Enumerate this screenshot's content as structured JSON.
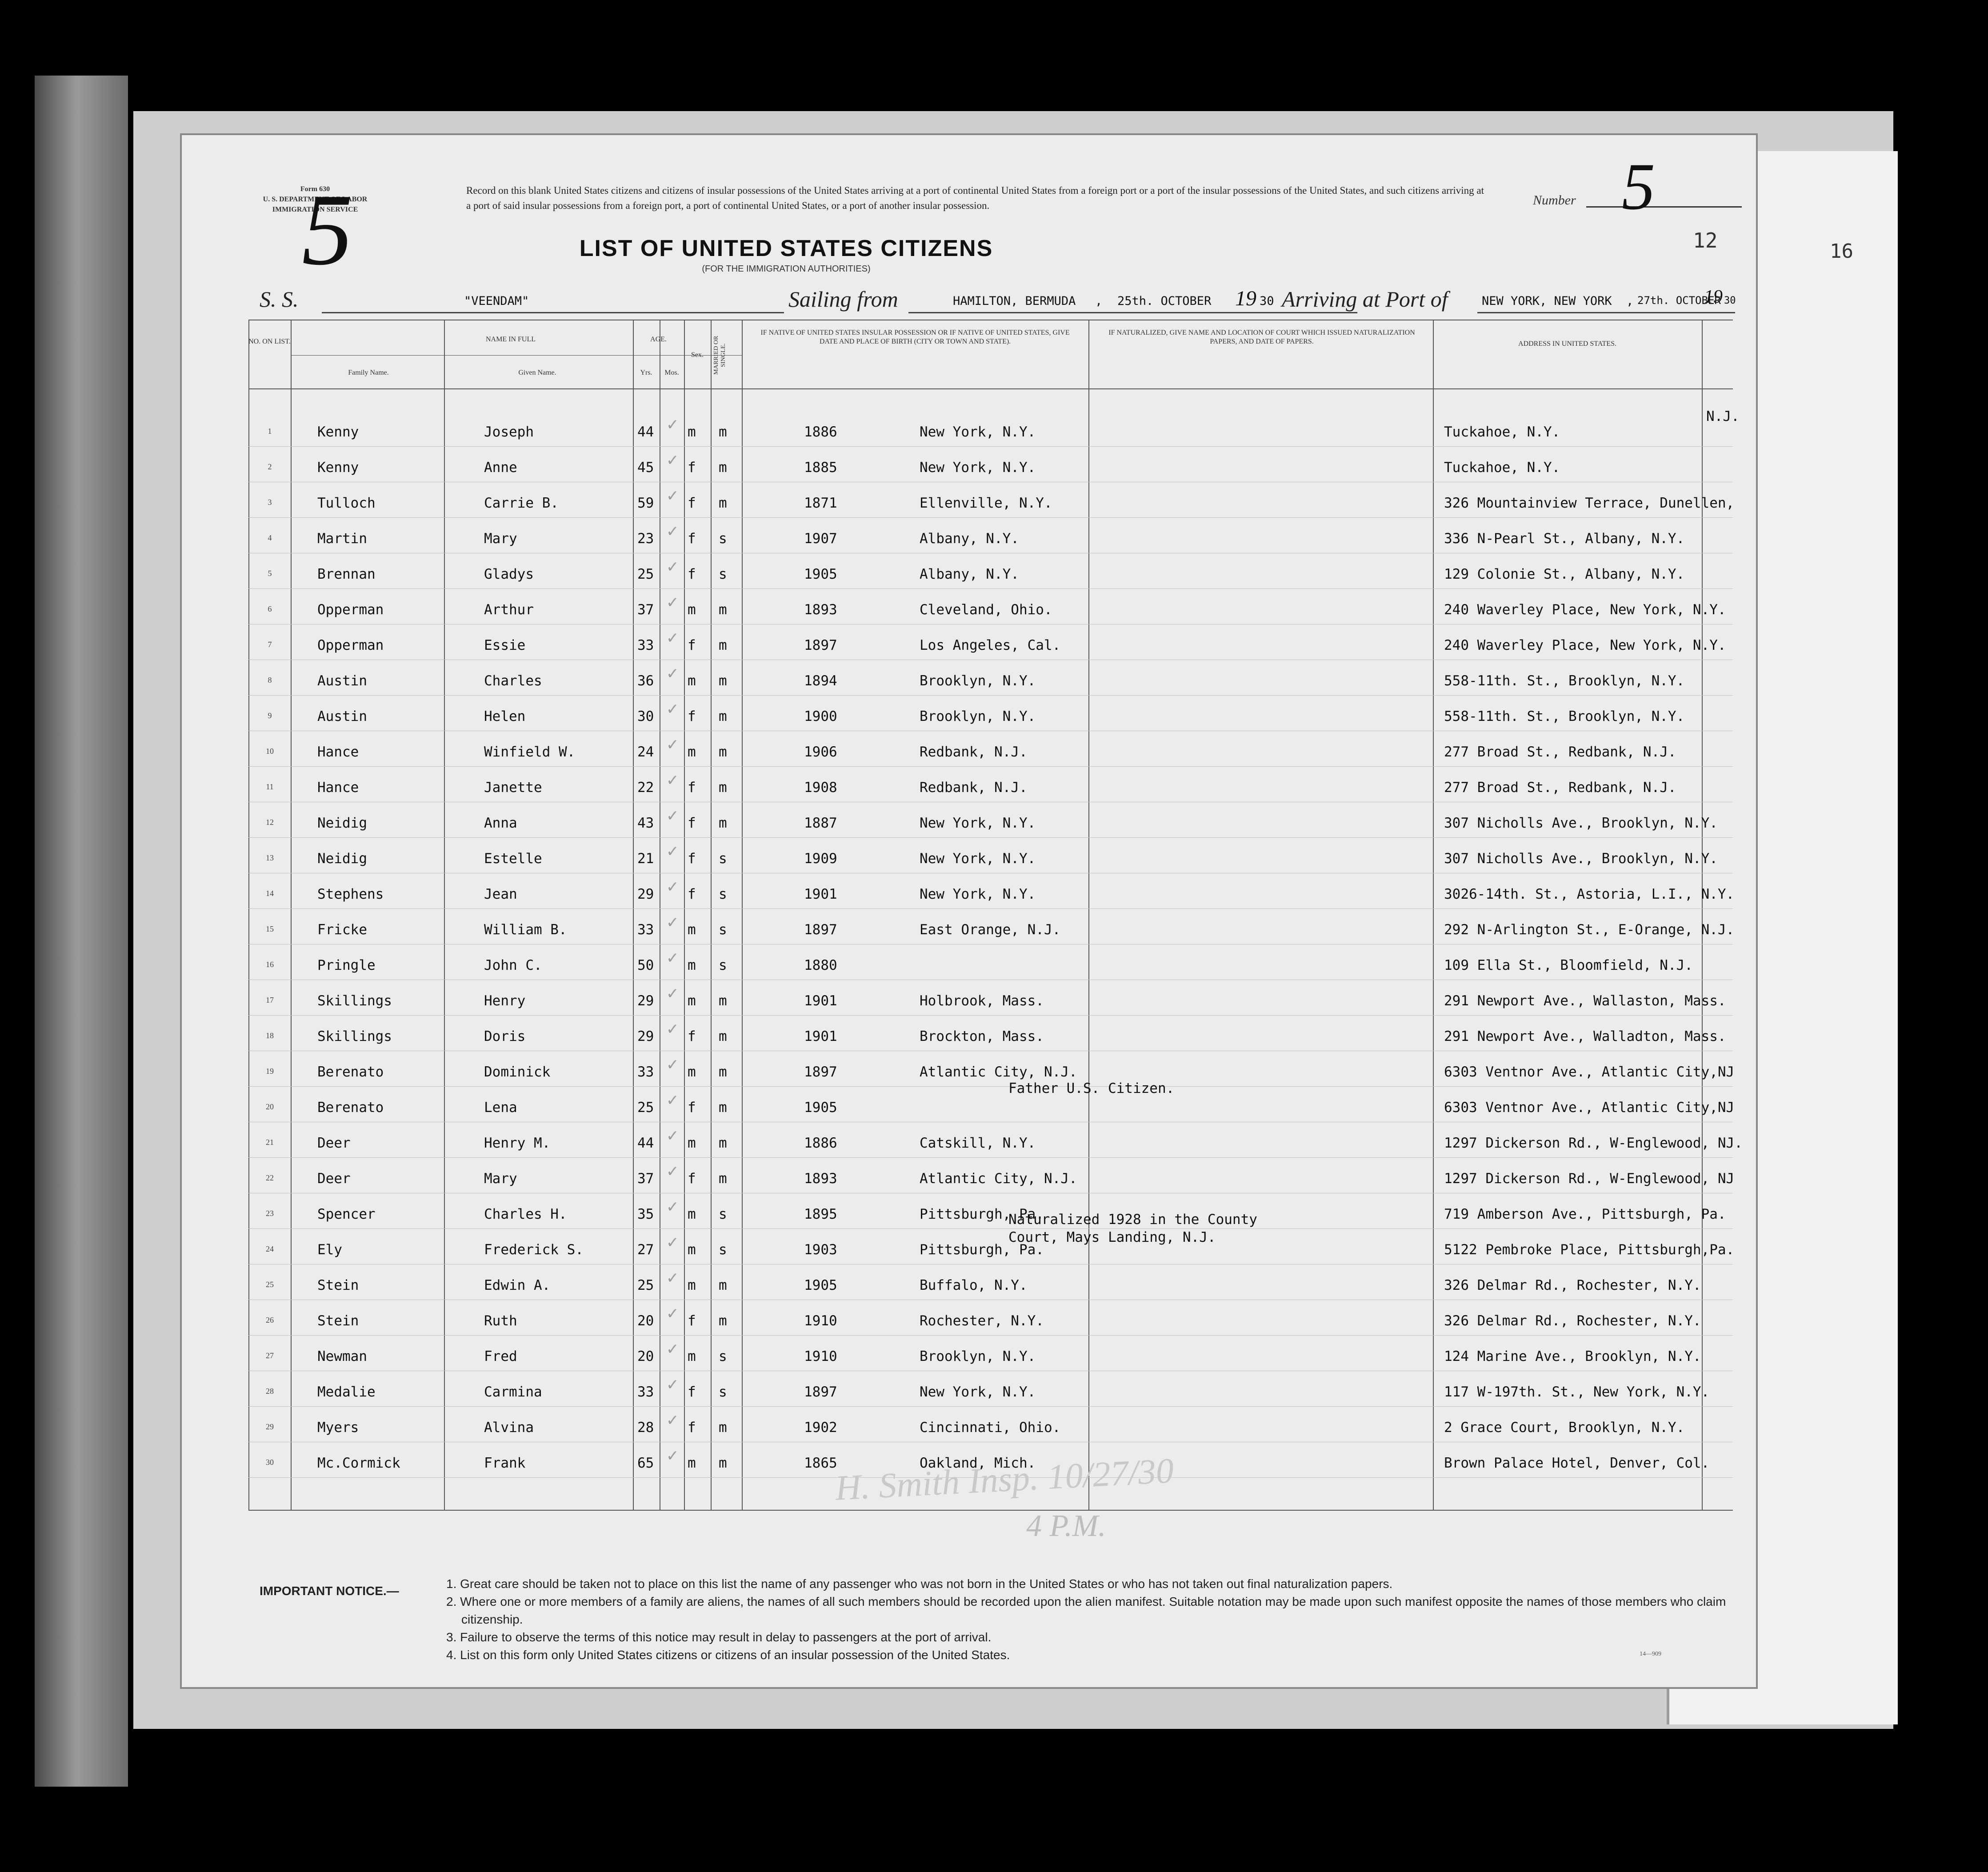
{
  "form": {
    "form_no": "Form 630",
    "department": "U. S. DEPARTMENT OF LABOR",
    "service": "IMMIGRATION SERVICE",
    "intro_text": "Record on this blank United States citizens and citizens of insular possessions of the United States arriving at a port of continental United States from a foreign port or a port of the insular possessions of the United States, and such citizens arriving at a port of said insular possessions from a foreign port, a port of continental United States, or a port of another insular possession.",
    "number_label": "Number",
    "number_value": "5",
    "handwritten_number": "5",
    "sheet_number": "12",
    "facing_page_number": "16",
    "title": "LIST OF UNITED STATES CITIZENS",
    "subtitle": "(FOR THE IMMIGRATION AUTHORITIES)"
  },
  "voyage": {
    "ss_label": "S. S.",
    "ship": "\"VEENDAM\"",
    "sailing_label": "Sailing from",
    "port_from": "HAMILTON, BERMUDA",
    "departure_date": "25th. OCTOBER",
    "departure_year_prefix": "19",
    "departure_year": "30",
    "arriving_label": "Arriving at Port of",
    "port_to": "NEW YORK, NEW YORK",
    "arrival_date": "27th. OCTOBER",
    "arrival_year_prefix": "19",
    "arrival_year": "30"
  },
  "columns": {
    "no": "No. on List.",
    "name_in_full": "NAME IN FULL",
    "family_name": "Family Name.",
    "given_name": "Given Name.",
    "age": "AGE.",
    "yrs": "Yrs.",
    "mos": "Mos.",
    "sex": "Sex.",
    "married": "Married or Single.",
    "birth": "IF NATIVE OF UNITED STATES INSULAR POSSESSION OR IF NATIVE OF UNITED STATES, GIVE DATE AND PLACE OF BIRTH (CITY OR TOWN AND STATE).",
    "naturalized": "IF NATURALIZED, GIVE NAME AND LOCATION OF COURT WHICH ISSUED NATURALIZATION PAPERS, AND DATE OF PAPERS.",
    "address": "ADDRESS IN UNITED STATES."
  },
  "passengers": [
    {
      "no": "1",
      "family": "Kenny",
      "given": "Joseph",
      "age": "44",
      "sex": "m",
      "marital": "m",
      "year": "1886",
      "place": "New York, N.Y.",
      "address": "Tuckahoe, N.Y."
    },
    {
      "no": "2",
      "family": "Kenny",
      "given": "Anne",
      "age": "45",
      "sex": "f",
      "marital": "m",
      "year": "1885",
      "place": "New York, N.Y.",
      "address": "Tuckahoe, N.Y."
    },
    {
      "no": "3",
      "family": "Tulloch",
      "given": "Carrie B.",
      "age": "59",
      "sex": "f",
      "marital": "m",
      "year": "1871",
      "place": "Ellenville, N.Y.",
      "address": "326 Mountainview Terrace, Dunellen,"
    },
    {
      "no": "4",
      "family": "Martin",
      "given": "Mary",
      "age": "23",
      "sex": "f",
      "marital": "s",
      "year": "1907",
      "place": "Albany, N.Y.",
      "address": "336 N-Pearl St., Albany, N.Y."
    },
    {
      "no": "5",
      "family": "Brennan",
      "given": "Gladys",
      "age": "25",
      "sex": "f",
      "marital": "s",
      "year": "1905",
      "place": "Albany, N.Y.",
      "address": "129 Colonie St., Albany, N.Y."
    },
    {
      "no": "6",
      "family": "Opperman",
      "given": "Arthur",
      "age": "37",
      "sex": "m",
      "marital": "m",
      "year": "1893",
      "place": "Cleveland, Ohio.",
      "address": "240 Waverley Place, New York, N.Y."
    },
    {
      "no": "7",
      "family": "Opperman",
      "given": "Essie",
      "age": "33",
      "sex": "f",
      "marital": "m",
      "year": "1897",
      "place": "Los Angeles, Cal.",
      "address": "240 Waverley Place, New York, N.Y."
    },
    {
      "no": "8",
      "family": "Austin",
      "given": "Charles",
      "age": "36",
      "sex": "m",
      "marital": "m",
      "year": "1894",
      "place": "Brooklyn, N.Y.",
      "address": "558-11th. St., Brooklyn, N.Y."
    },
    {
      "no": "9",
      "family": "Austin",
      "given": "Helen",
      "age": "30",
      "sex": "f",
      "marital": "m",
      "year": "1900",
      "place": "Brooklyn, N.Y.",
      "address": "558-11th. St., Brooklyn, N.Y."
    },
    {
      "no": "10",
      "family": "Hance",
      "given": "Winfield W.",
      "age": "24",
      "sex": "m",
      "marital": "m",
      "year": "1906",
      "place": "Redbank, N.J.",
      "address": "277 Broad St., Redbank, N.J."
    },
    {
      "no": "11",
      "family": "Hance",
      "given": "Janette",
      "age": "22",
      "sex": "f",
      "marital": "m",
      "year": "1908",
      "place": "Redbank, N.J.",
      "address": "277 Broad St., Redbank, N.J."
    },
    {
      "no": "12",
      "family": "Neidig",
      "given": "Anna",
      "age": "43",
      "sex": "f",
      "marital": "m",
      "year": "1887",
      "place": "New York, N.Y.",
      "address": "307 Nicholls Ave., Brooklyn, N.Y."
    },
    {
      "no": "13",
      "family": "Neidig",
      "given": "Estelle",
      "age": "21",
      "sex": "f",
      "marital": "s",
      "year": "1909",
      "place": "New York, N.Y.",
      "address": "307 Nicholls Ave., Brooklyn, N.Y."
    },
    {
      "no": "14",
      "family": "Stephens",
      "given": "Jean",
      "age": "29",
      "sex": "f",
      "marital": "s",
      "year": "1901",
      "place": "New York, N.Y.",
      "address": "3026-14th. St., Astoria, L.I., N.Y."
    },
    {
      "no": "15",
      "family": "Fricke",
      "given": "William B.",
      "age": "33",
      "sex": "m",
      "marital": "s",
      "year": "1897",
      "place": "East Orange, N.J.",
      "address": "292 N-Arlington St., E-Orange, N.J."
    },
    {
      "no": "16",
      "family": "Pringle",
      "given": "John C.",
      "age": "50",
      "sex": "m",
      "marital": "s",
      "year": "1880",
      "place": "",
      "address": "109 Ella St., Bloomfield, N.J."
    },
    {
      "no": "17",
      "family": "Skillings",
      "given": "Henry",
      "age": "29",
      "sex": "m",
      "marital": "m",
      "year": "1901",
      "place": "Holbrook, Mass.",
      "address": "291 Newport Ave., Wallaston, Mass."
    },
    {
      "no": "18",
      "family": "Skillings",
      "given": "Doris",
      "age": "29",
      "sex": "f",
      "marital": "m",
      "year": "1901",
      "place": "Brockton, Mass.",
      "address": "291 Newport Ave., Walladton, Mass."
    },
    {
      "no": "19",
      "family": "Berenato",
      "given": "Dominick",
      "age": "33",
      "sex": "m",
      "marital": "m",
      "year": "1897",
      "place": "Atlantic City, N.J.",
      "address": "6303 Ventnor Ave., Atlantic City,NJ"
    },
    {
      "no": "20",
      "family": "Berenato",
      "given": "Lena",
      "age": "25",
      "sex": "f",
      "marital": "m",
      "year": "1905",
      "place": "",
      "address": "6303 Ventnor Ave., Atlantic City,NJ"
    },
    {
      "no": "21",
      "family": "Deer",
      "given": "Henry M.",
      "age": "44",
      "sex": "m",
      "marital": "m",
      "year": "1886",
      "place": "Catskill, N.Y.",
      "address": "1297 Dickerson Rd., W-Englewood, NJ."
    },
    {
      "no": "22",
      "family": "Deer",
      "given": "Mary",
      "age": "37",
      "sex": "f",
      "marital": "m",
      "year": "1893",
      "place": "Atlantic City, N.J.",
      "address": "1297 Dickerson Rd., W-Englewood, NJ"
    },
    {
      "no": "23",
      "family": "Spencer",
      "given": "Charles H.",
      "age": "35",
      "sex": "m",
      "marital": "s",
      "year": "1895",
      "place": "Pittsburgh, Pa.",
      "address": "719 Amberson Ave., Pittsburgh, Pa."
    },
    {
      "no": "24",
      "family": "Ely",
      "given": "Frederick S.",
      "age": "27",
      "sex": "m",
      "marital": "s",
      "year": "1903",
      "place": "Pittsburgh, Pa.",
      "address": "5122 Pembroke Place, Pittsburgh,Pa."
    },
    {
      "no": "25",
      "family": "Stein",
      "given": "Edwin A.",
      "age": "25",
      "sex": "m",
      "marital": "m",
      "year": "1905",
      "place": "Buffalo, N.Y.",
      "address": "326 Delmar Rd., Rochester, N.Y."
    },
    {
      "no": "26",
      "family": "Stein",
      "given": "Ruth",
      "age": "20",
      "sex": "f",
      "marital": "m",
      "year": "1910",
      "place": "Rochester, N.Y.",
      "address": "326 Delmar Rd., Rochester, N.Y."
    },
    {
      "no": "27",
      "family": "Newman",
      "given": "Fred",
      "age": "20",
      "sex": "m",
      "marital": "s",
      "year": "1910",
      "place": "Brooklyn, N.Y.",
      "address": "124 Marine Ave., Brooklyn, N.Y."
    },
    {
      "no": "28",
      "family": "Medalie",
      "given": "Carmina",
      "age": "33",
      "sex": "f",
      "marital": "s",
      "year": "1897",
      "place": "New York, N.Y.",
      "address": "117 W-197th. St., New York, N.Y."
    },
    {
      "no": "29",
      "family": "Myers",
      "given": "Alvina",
      "age": "28",
      "sex": "f",
      "marital": "m",
      "year": "1902",
      "place": "Cincinnati, Ohio.",
      "address": "2 Grace Court, Brooklyn, N.Y."
    },
    {
      "no": "30",
      "family": "Mc.Cormick",
      "given": "Frank",
      "age": "65",
      "sex": "m",
      "marital": "m",
      "year": "1865",
      "place": "Oakland, Mich.",
      "address": "Brown Palace Hotel, Denver, Col."
    }
  ],
  "address_overflow_row3": "N.J.",
  "notes": {
    "pringle": "Father U.S. Citizen.",
    "berenato": "Naturalized 1928 in the County\nCourt, Mays Landing, N.J."
  },
  "inspector_signature": "H. Smith Insp. 10/27/30",
  "inspector_time": "4 P.M.",
  "notice": {
    "title": "IMPORTANT NOTICE.—",
    "items": [
      "1. Great care should be taken not to place on this list the name of any passenger who was not born in the United States or who has not taken out final naturalization papers.",
      "2. Where one or more members of a family are aliens, the names of all such members should be recorded upon the alien manifest. Suitable notation may be made upon such manifest opposite the names of those members who claim citizenship.",
      "3. Failure to observe the terms of this notice may result in delay to passengers at the port of arrival.",
      "4. List on this form only United States citizens or citizens of an insular possession of the United States."
    ],
    "form_code": "14—909"
  }
}
